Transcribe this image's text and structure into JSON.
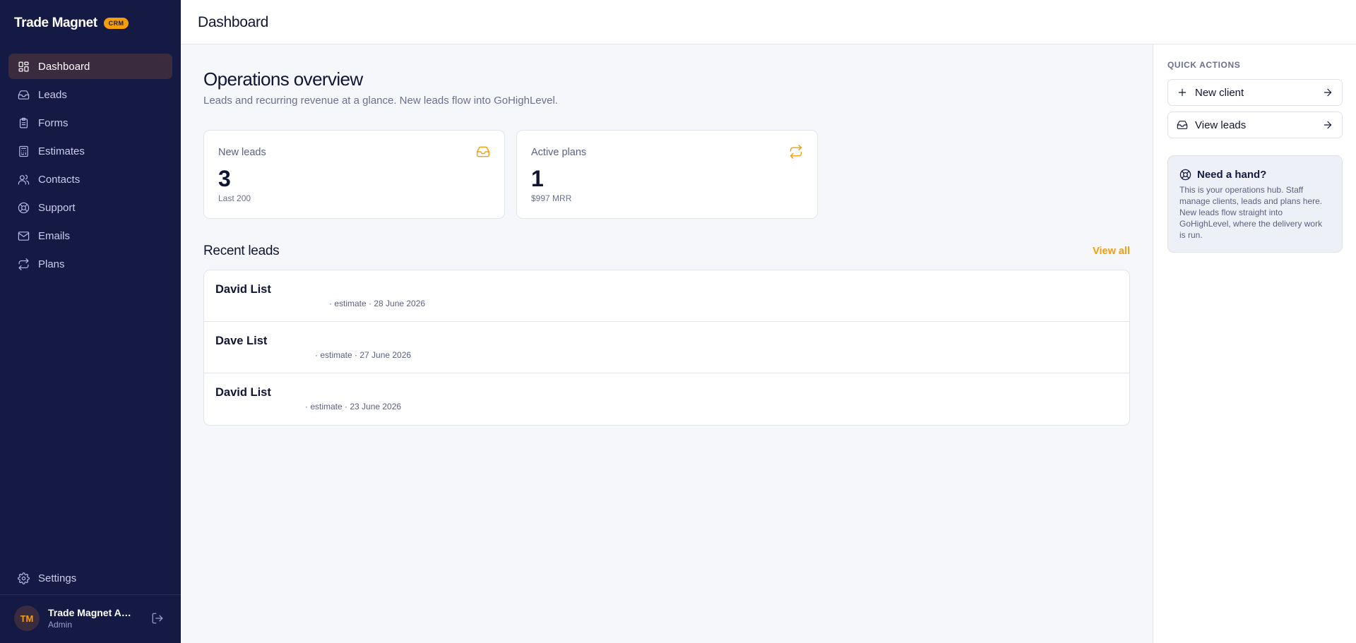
{
  "brand": {
    "name": "Trade Magnet",
    "badge": "CRM"
  },
  "sidebar": {
    "items": [
      {
        "label": "Dashboard",
        "icon": "dashboard-icon",
        "active": true
      },
      {
        "label": "Leads",
        "icon": "inbox-icon"
      },
      {
        "label": "Forms",
        "icon": "clipboard-icon"
      },
      {
        "label": "Estimates",
        "icon": "calculator-icon"
      },
      {
        "label": "Contacts",
        "icon": "users-icon"
      },
      {
        "label": "Support",
        "icon": "lifebuoy-icon"
      },
      {
        "label": "Emails",
        "icon": "mail-icon"
      },
      {
        "label": "Plans",
        "icon": "repeat-icon"
      }
    ],
    "settings": {
      "label": "Settings",
      "icon": "gear-icon"
    },
    "user": {
      "initials": "TM",
      "name": "Trade Magnet Admin",
      "role": "Admin"
    }
  },
  "topbar": {
    "title": "Dashboard"
  },
  "main": {
    "heading": "Operations overview",
    "subheading": "Leads and recurring revenue at a glance. New leads flow into GoHighLevel.",
    "stats": [
      {
        "label": "New leads",
        "value": "3",
        "foot": "Last 200",
        "icon": "inbox-icon"
      },
      {
        "label": "Active plans",
        "value": "1",
        "foot": "$997 MRR",
        "icon": "repeat-icon"
      }
    ],
    "recent": {
      "title": "Recent leads",
      "view_all": "View all",
      "leads": [
        {
          "name": "David List",
          "meta": "· estimate · 28 June 2026"
        },
        {
          "name": "Dave List",
          "meta": "· estimate · 27 June 2026"
        },
        {
          "name": "David List",
          "meta": "· estimate · 23 June 2026"
        }
      ]
    }
  },
  "quick_actions": {
    "title": "QUICK ACTIONS",
    "buttons": [
      {
        "label": "New client",
        "icon": "plus-icon"
      },
      {
        "label": "View leads",
        "icon": "inbox-icon"
      }
    ]
  },
  "help": {
    "title": "Need a hand?",
    "body": "This is your operations hub. Staff manage clients, leads and plans here. New leads flow straight into GoHighLevel, where the delivery work is run."
  },
  "colors": {
    "sidebar": "#151a45",
    "accent": "#f59e0b",
    "active_nav": "#3a2b3f"
  }
}
